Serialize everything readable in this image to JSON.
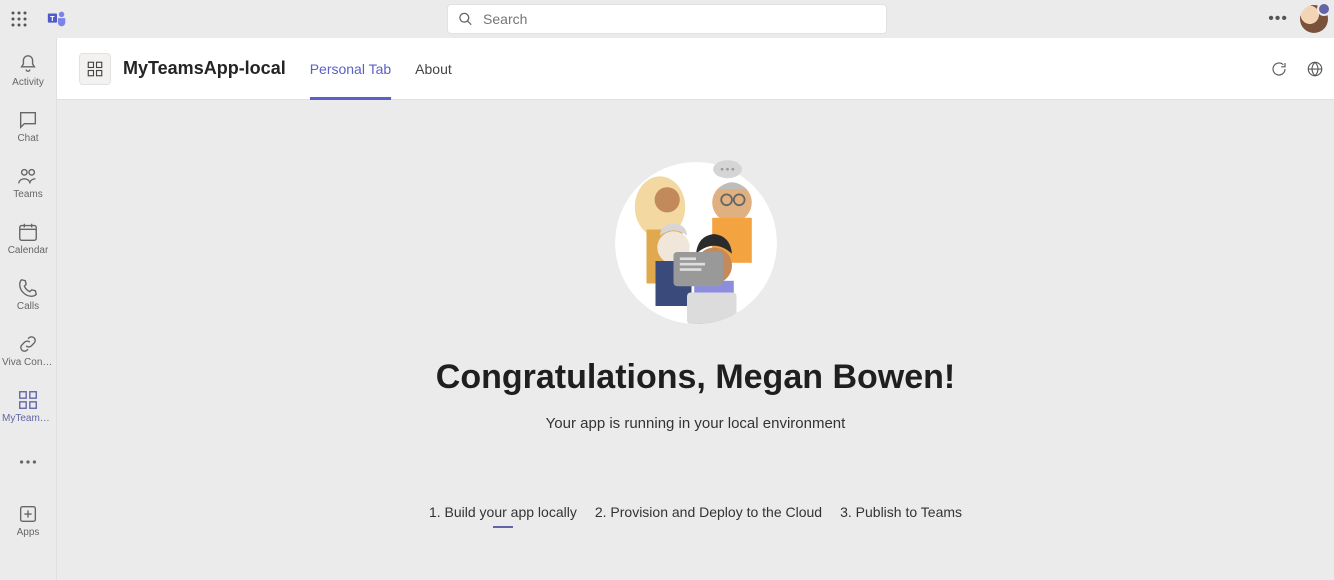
{
  "titlebar": {
    "search_placeholder": "Search"
  },
  "rail": [
    {
      "key": "activity",
      "label": "Activity"
    },
    {
      "key": "chat",
      "label": "Chat"
    },
    {
      "key": "teams",
      "label": "Teams"
    },
    {
      "key": "calendar",
      "label": "Calendar"
    },
    {
      "key": "calls",
      "label": "Calls"
    },
    {
      "key": "viva",
      "label": "Viva Conne..."
    },
    {
      "key": "app",
      "label": "MyTeamsA..."
    },
    {
      "key": "more",
      "label": ""
    },
    {
      "key": "apps",
      "label": "Apps"
    }
  ],
  "header": {
    "app_name": "MyTeamsApp-local",
    "tabs": [
      {
        "label": "Personal Tab",
        "active": true
      },
      {
        "label": "About",
        "active": false
      }
    ]
  },
  "canvas": {
    "title": "Congratulations, Megan Bowen!",
    "subtitle": "Your app is running in your local environment",
    "steps": [
      {
        "label": "1. Build your app locally",
        "active": true
      },
      {
        "label": "2. Provision and Deploy to the Cloud",
        "active": false
      },
      {
        "label": "3. Publish to Teams",
        "active": false
      }
    ]
  }
}
